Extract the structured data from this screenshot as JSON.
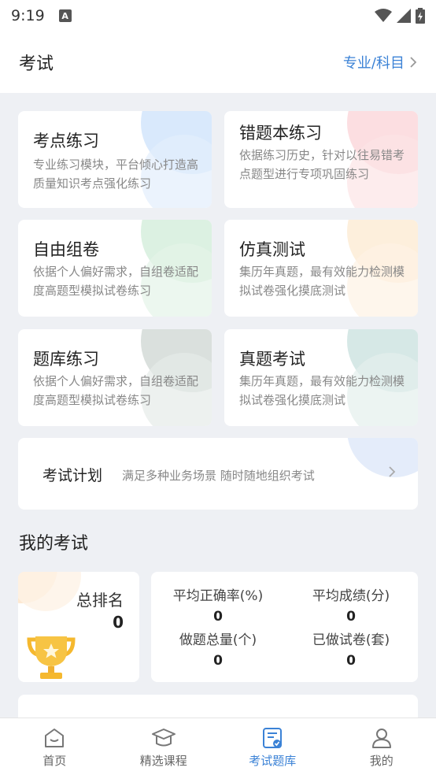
{
  "status": {
    "time": "9:19",
    "notif_letter": "A"
  },
  "header": {
    "title": "考试",
    "subject_link": "专业/科目"
  },
  "cards": [
    {
      "title": "考点练习",
      "desc": "专业练习模块，平台倾心打造高质量知识考点强化练习",
      "accent": "#cfe3fb"
    },
    {
      "title": "错题本练习",
      "desc": "依据练习历史，针对以往易错考点题型进行专项巩固练习",
      "accent": "#fbd6da"
    },
    {
      "title": "自由组卷",
      "desc": "依据个人偏好需求，自组卷适配度高题型模拟试卷练习",
      "accent": "#d3eedb"
    },
    {
      "title": "仿真测试",
      "desc": "集历年真题，最有效能力检测模拟试卷强化摸底测试",
      "accent": "#fdebd3"
    },
    {
      "title": "题库练习",
      "desc": "依据个人偏好需求，自组卷适配度高题型模拟试卷练习",
      "accent": "#d6ddd9"
    },
    {
      "title": "真题考试",
      "desc": "集历年真题，最有效能力检测模拟试卷强化摸底测试",
      "accent": "#d2e6e3"
    }
  ],
  "plan": {
    "title": "考试计划",
    "desc": "满足多种业务场景 随时随地组织考试"
  },
  "my_exam": {
    "title": "我的考试",
    "rank_label": "总排名",
    "rank_value": "0",
    "stats": [
      {
        "label": "平均正确率(%)",
        "value": "0"
      },
      {
        "label": "平均成绩(分)",
        "value": "0"
      },
      {
        "label": "做题总量(个)",
        "value": "0"
      },
      {
        "label": "已做试卷(套)",
        "value": "0"
      }
    ]
  },
  "tabs": [
    {
      "label": "首页",
      "icon": "home-icon"
    },
    {
      "label": "精选课程",
      "icon": "graduation-cap-icon"
    },
    {
      "label": "考试题库",
      "icon": "exam-doc-icon",
      "active": true
    },
    {
      "label": "我的",
      "icon": "user-icon"
    }
  ],
  "colors": {
    "accent": "#3b82d6",
    "background": "#eef0f4"
  }
}
